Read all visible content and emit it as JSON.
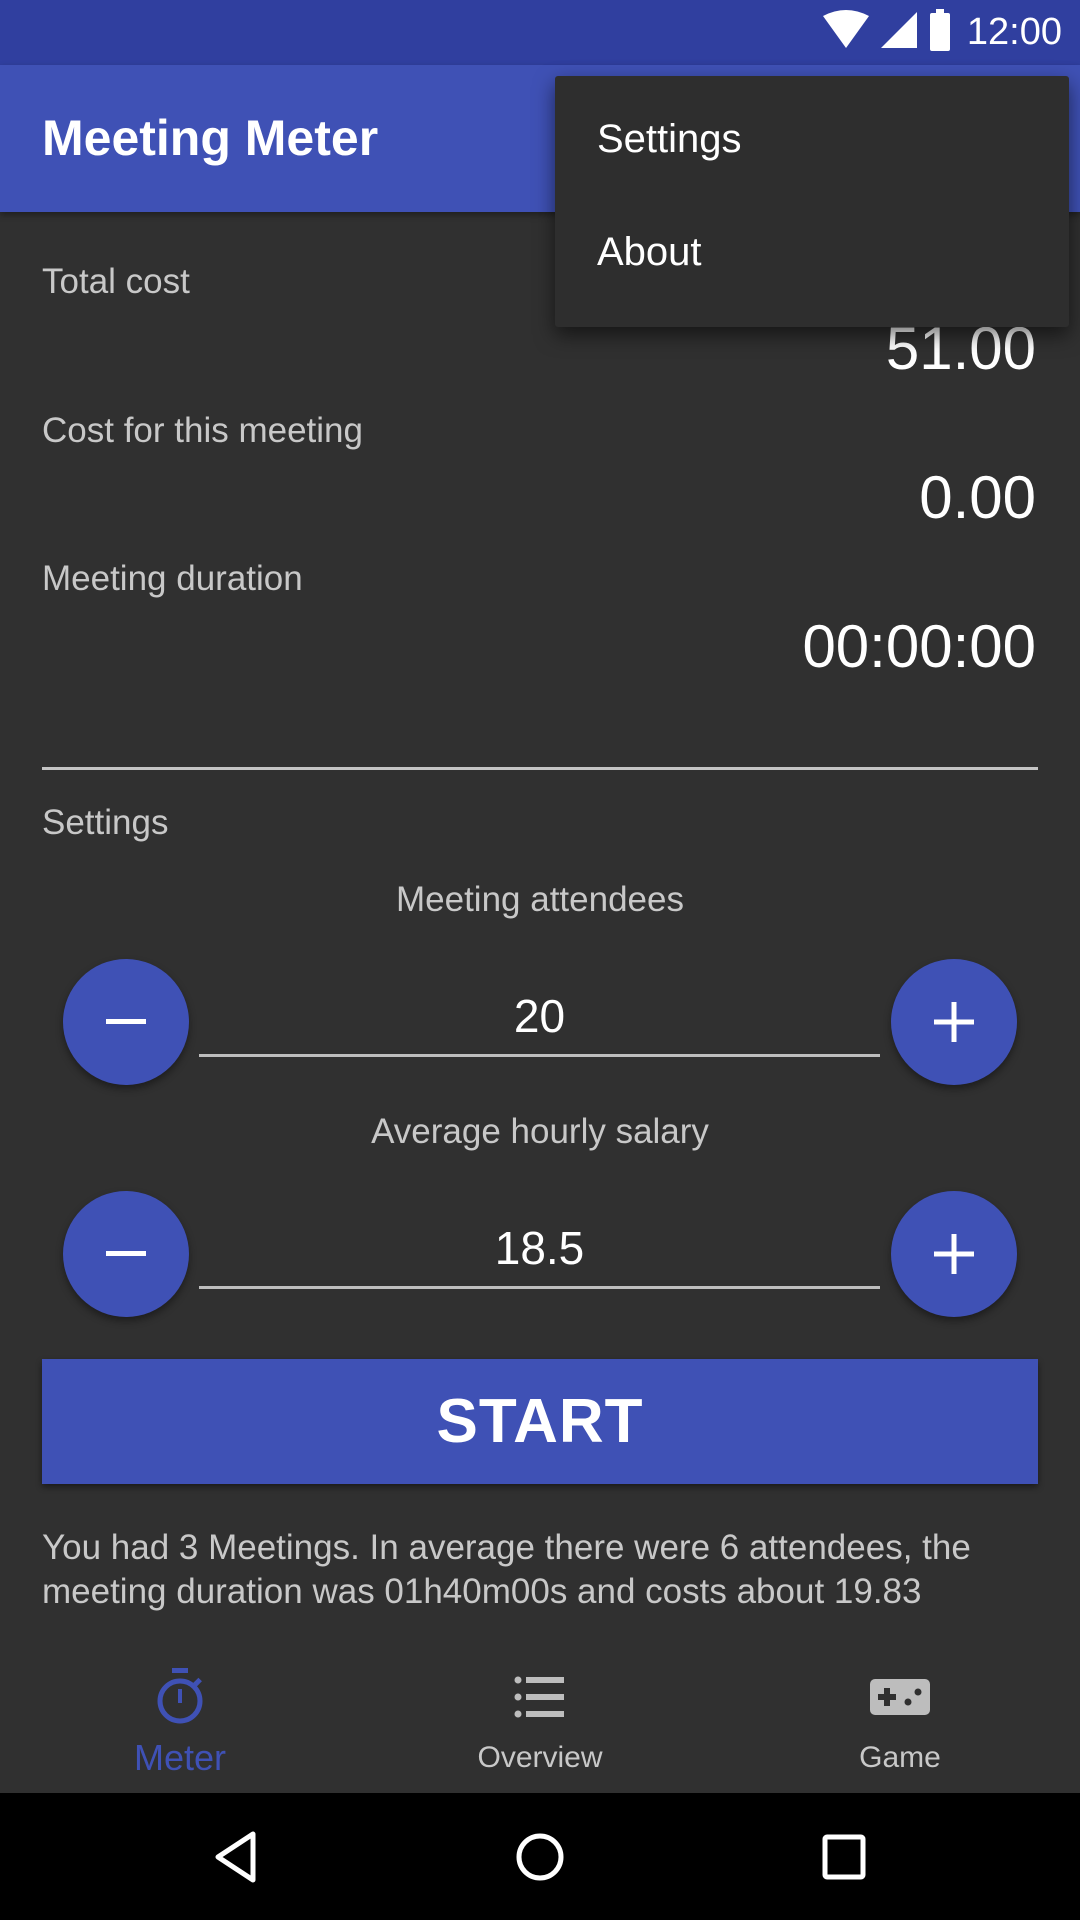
{
  "status_bar": {
    "time": "12:00",
    "icons": [
      "wifi-icon",
      "signal-icon",
      "battery-icon"
    ]
  },
  "app_bar": {
    "title": "Meeting Meter"
  },
  "overflow_menu": {
    "items": [
      {
        "label": "Settings"
      },
      {
        "label": "About"
      }
    ]
  },
  "meter": {
    "total_cost_label": "Total cost",
    "total_cost_value": "51.00",
    "meeting_cost_label": "Cost for this meeting",
    "meeting_cost_value": "0.00",
    "duration_label": "Meeting duration",
    "duration_value": "00:00:00"
  },
  "settings": {
    "section_label": "Settings",
    "attendees": {
      "label": "Meeting attendees",
      "value": "20",
      "decrement_icon": "minus-icon",
      "increment_icon": "plus-icon"
    },
    "salary": {
      "label": "Average hourly salary",
      "value": "18.5",
      "decrement_icon": "minus-icon",
      "increment_icon": "plus-icon"
    }
  },
  "start_button": {
    "label": "START"
  },
  "summary": {
    "text": "You had 3 Meetings. In average there were 6 attendees, the meeting duration was 01h40m00s and costs about 19.83"
  },
  "bottom_nav": {
    "items": [
      {
        "label": "Meter",
        "icon": "stopwatch-icon",
        "active": true
      },
      {
        "label": "Overview",
        "icon": "list-icon",
        "active": false
      },
      {
        "label": "Game",
        "icon": "gamepad-icon",
        "active": false
      }
    ]
  },
  "colors": {
    "primary": "#3F51B5",
    "primary_dark": "#303F9F",
    "background": "#303030",
    "menu_background": "#2e2e2e",
    "text_secondary": "#c8c8c8"
  }
}
